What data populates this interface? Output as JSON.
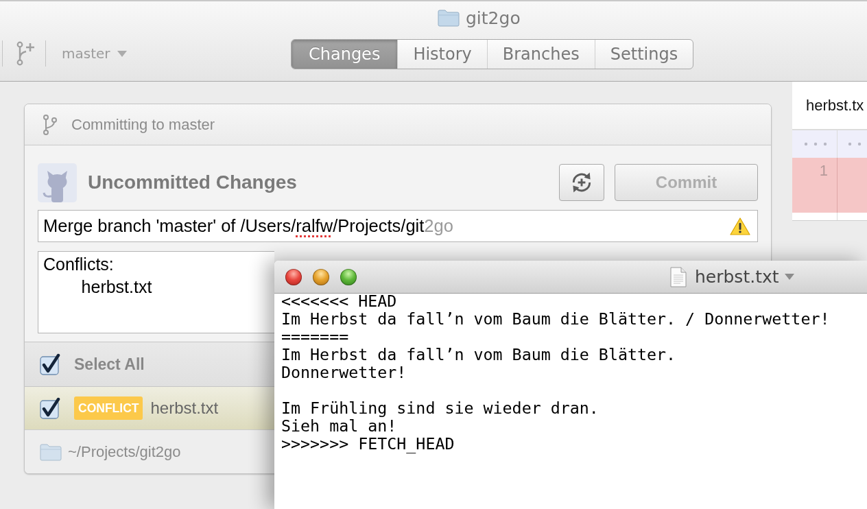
{
  "window": {
    "title": "git2go"
  },
  "toolbar": {
    "branch": "master",
    "tabs": [
      {
        "label": "Changes",
        "selected": true
      },
      {
        "label": "History",
        "selected": false
      },
      {
        "label": "Branches",
        "selected": false
      },
      {
        "label": "Settings",
        "selected": false
      }
    ]
  },
  "commit_panel": {
    "header": "Committing to master",
    "title": "Uncommitted Changes",
    "commit_button": {
      "label": "Commit",
      "disabled": true
    },
    "summary": {
      "segments": [
        {
          "kind": "plain",
          "text": "Merge branch 'master' of /Users/"
        },
        {
          "kind": "misspelled",
          "text": "ralfw"
        },
        {
          "kind": "plain",
          "text": "/Projects/git"
        },
        {
          "kind": "overflow",
          "text": "2go"
        }
      ],
      "warning": true
    },
    "description": "Conflicts:\n\therbst.txt",
    "select_all": {
      "label": "Select All",
      "checked": true
    },
    "files": [
      {
        "name": "herbst.txt",
        "status": {
          "kind": "conflict",
          "label": "CONFLICT"
        },
        "checked": true,
        "selected": true
      }
    ],
    "repository_path": "~/Projects/git2go"
  },
  "diff_panel": {
    "file": "herbst.tx",
    "rows": [
      {
        "kind": "hunk"
      },
      {
        "kind": "deleted",
        "old_line": "1"
      }
    ]
  },
  "editor": {
    "title": "herbst.txt",
    "text": "<<<<<<< HEAD\nIm Herbst da fall’n vom Baum die Blätter. / Donnerwetter!\n=======\nIm Herbst da fall’n vom Baum die Blätter.\nDonnerwetter!\n\nIm Frühling sind sie wieder dran.\nSieh mal an!\n>>>>>>> FETCH_HEAD"
  }
}
